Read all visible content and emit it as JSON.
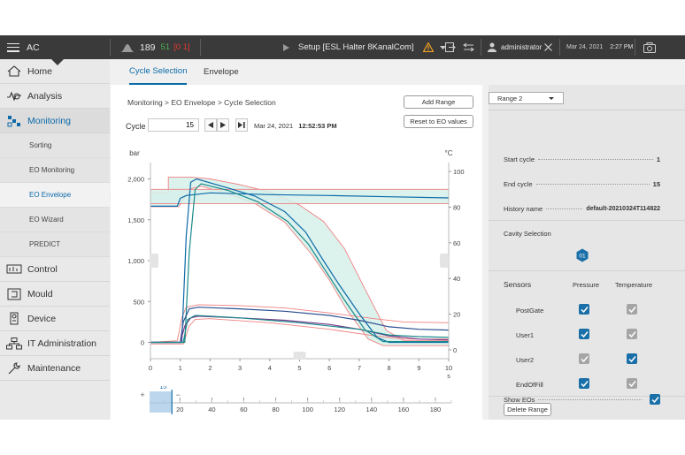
{
  "app": {
    "name": "AC"
  },
  "topbar": {
    "cycle_counter": "189",
    "status_counts": {
      "green": "51",
      "red_bracket": "[0 1]"
    },
    "setup_title": "Setup [ESL Halter 8KanalCom]",
    "user": "administrator",
    "date": "Mar 24, 2021",
    "time": "2:27 PM",
    "colors": {
      "bar": "#3a3a3a",
      "green": "#4caf50",
      "red": "#e53935",
      "warning": "#f0a020"
    }
  },
  "sidebar": {
    "items": [
      {
        "label": "Home",
        "icon": "home-icon"
      },
      {
        "label": "Analysis",
        "icon": "analysis-icon"
      },
      {
        "label": "Monitoring",
        "icon": "monitoring-icon",
        "active": true
      },
      {
        "label": "Control",
        "icon": "control-icon"
      },
      {
        "label": "Mould",
        "icon": "mould-icon"
      },
      {
        "label": "Device",
        "icon": "device-icon"
      },
      {
        "label": "IT Administration",
        "icon": "it-admin-icon"
      },
      {
        "label": "Maintenance",
        "icon": "maintenance-icon"
      }
    ],
    "subitems": [
      {
        "label": "Sorting"
      },
      {
        "label": "EO Monitoring"
      },
      {
        "label": "EO Envelope",
        "active": true
      },
      {
        "label": "EO Wizard"
      },
      {
        "label": "PREDICT"
      }
    ]
  },
  "tabs": [
    {
      "label": "Cycle Selection",
      "active": true
    },
    {
      "label": "Envelope"
    }
  ],
  "main": {
    "breadcrumb": "Monitoring > EO Envelope > Cycle Selection",
    "cycle_label": "Cycle",
    "cycle_value": "15",
    "cycle_date": "Mar 24, 2021",
    "cycle_time": "12:52:53 PM",
    "add_range_label": "Add Range",
    "reset_label": "Reset to EO values"
  },
  "chart_data": {
    "type": "line",
    "y_left_label": "bar",
    "y_right_label": "°C",
    "x_unit": "s",
    "xlim": [
      0,
      10
    ],
    "ylim_left": [
      -200,
      2200
    ],
    "ylim_right": [
      -5,
      105
    ],
    "x_ticks": [
      "0",
      "1",
      "2",
      "3",
      "4",
      "5",
      "6",
      "7",
      "8",
      "9",
      "10"
    ],
    "y_left_ticks": [
      "2,000",
      "1,500",
      "1,000",
      "500",
      "0"
    ],
    "y_left_tick_values": [
      2000,
      1500,
      1000,
      500,
      0
    ],
    "y_right_ticks": [
      "100",
      "80",
      "60",
      "40",
      "20",
      "0"
    ],
    "y_right_tick_values": [
      100,
      80,
      60,
      40,
      20,
      0
    ],
    "envelopes": [
      {
        "axis": "left",
        "color": "#f08080",
        "fill": "#d6f0ea",
        "upper": [
          [
            0,
            1830
          ],
          [
            0.6,
            1830
          ],
          [
            0.6,
            2020
          ],
          [
            1.4,
            2020
          ],
          [
            2.0,
            2000
          ],
          [
            3.0,
            1930
          ],
          [
            4.0,
            1840
          ],
          [
            5.0,
            1680
          ],
          [
            5.8,
            1480
          ],
          [
            6.5,
            1150
          ],
          [
            7.2,
            650
          ],
          [
            7.9,
            150
          ],
          [
            8.5,
            20
          ],
          [
            10,
            20
          ]
        ],
        "lower": [
          [
            0,
            1660
          ],
          [
            0.95,
            1660
          ],
          [
            1.35,
            1880
          ],
          [
            1.7,
            1910
          ],
          [
            2.5,
            1830
          ],
          [
            3.5,
            1700
          ],
          [
            4.5,
            1470
          ],
          [
            5.4,
            1080
          ],
          [
            6.0,
            760
          ],
          [
            6.6,
            390
          ],
          [
            7.3,
            40
          ],
          [
            7.8,
            -40
          ],
          [
            10,
            -40
          ]
        ]
      },
      {
        "axis": "left",
        "color": "#f08080",
        "fill": "none",
        "upper": [
          [
            0,
            0
          ],
          [
            0.9,
            20
          ],
          [
            1.05,
            300
          ],
          [
            1.2,
            430
          ],
          [
            1.6,
            460
          ],
          [
            3,
            450
          ],
          [
            4.5,
            420
          ],
          [
            6,
            360
          ],
          [
            7.5,
            290
          ],
          [
            8.5,
            250
          ],
          [
            10,
            240
          ]
        ],
        "lower": [
          [
            0,
            -20
          ],
          [
            1.1,
            -20
          ],
          [
            1.3,
            200
          ],
          [
            1.5,
            280
          ],
          [
            2,
            290
          ],
          [
            4,
            240
          ],
          [
            6,
            160
          ],
          [
            7.5,
            80
          ],
          [
            8.5,
            40
          ],
          [
            10,
            40
          ]
        ]
      },
      {
        "axis": "right",
        "color": "#f08080",
        "fill": "#d6f0ea",
        "upper": [
          [
            0,
            90
          ],
          [
            10,
            90
          ]
        ],
        "lower": [
          [
            0,
            82
          ],
          [
            10,
            82
          ]
        ]
      }
    ],
    "series": [
      {
        "name": "Temperature",
        "axis": "right",
        "color": "#0b6aa8",
        "points": [
          [
            0,
            80.5
          ],
          [
            0.9,
            80.5
          ],
          [
            1.0,
            85
          ],
          [
            1.2,
            86.5
          ],
          [
            2,
            88
          ],
          [
            4,
            87
          ],
          [
            6,
            86.5
          ],
          [
            8,
            85.8
          ],
          [
            10,
            85.2
          ]
        ]
      },
      {
        "name": "Pressure",
        "axis": "left",
        "color": "#0b6aa8",
        "points": [
          [
            0,
            0
          ],
          [
            1.05,
            0
          ],
          [
            1.2,
            1300
          ],
          [
            1.35,
            1960
          ],
          [
            1.55,
            2000
          ],
          [
            2.5,
            1900
          ],
          [
            3.5,
            1790
          ],
          [
            4.5,
            1600
          ],
          [
            5.2,
            1350
          ],
          [
            5.8,
            1000
          ],
          [
            6.3,
            720
          ],
          [
            7.0,
            350
          ],
          [
            7.6,
            60
          ],
          [
            8.0,
            0
          ],
          [
            10,
            0
          ]
        ]
      },
      {
        "name": "Pressure",
        "axis": "left",
        "color": "#1a8a8a",
        "points": [
          [
            0,
            0
          ],
          [
            1.15,
            0
          ],
          [
            1.3,
            1100
          ],
          [
            1.5,
            1870
          ],
          [
            1.7,
            1940
          ],
          [
            2.6,
            1860
          ],
          [
            3.6,
            1720
          ],
          [
            4.6,
            1480
          ],
          [
            5.3,
            1200
          ],
          [
            5.9,
            860
          ],
          [
            6.5,
            520
          ],
          [
            7.2,
            150
          ],
          [
            7.8,
            10
          ],
          [
            10,
            10
          ]
        ]
      },
      {
        "name": "User1",
        "axis": "left",
        "color": "#2a4f8f",
        "points": [
          [
            0,
            0
          ],
          [
            1.0,
            0
          ],
          [
            1.1,
            250
          ],
          [
            1.3,
            410
          ],
          [
            1.6,
            430
          ],
          [
            3,
            410
          ],
          [
            4.5,
            380
          ],
          [
            6,
            330
          ],
          [
            7,
            270
          ],
          [
            8,
            190
          ],
          [
            9,
            160
          ],
          [
            10,
            150
          ]
        ]
      },
      {
        "name": "User1",
        "axis": "left",
        "color": "#7a3a8a",
        "points": [
          [
            0,
            0
          ],
          [
            1.0,
            0
          ],
          [
            1.15,
            200
          ],
          [
            1.35,
            300
          ],
          [
            1.6,
            320
          ],
          [
            3,
            300
          ],
          [
            4.5,
            270
          ],
          [
            6,
            220
          ],
          [
            7,
            160
          ],
          [
            8,
            80
          ],
          [
            9,
            40
          ],
          [
            10,
            30
          ]
        ]
      },
      {
        "name": "EndOfFill",
        "axis": "left",
        "color": "#1a8a8a",
        "points": [
          [
            0,
            0
          ],
          [
            1.1,
            0
          ],
          [
            1.25,
            280
          ],
          [
            1.5,
            330
          ],
          [
            3,
            300
          ],
          [
            5,
            240
          ],
          [
            7,
            160
          ],
          [
            8,
            90
          ],
          [
            9,
            70
          ],
          [
            10,
            60
          ]
        ]
      }
    ]
  },
  "timeline": {
    "selected": "15",
    "labels": [
      "20",
      "40",
      "60",
      "80",
      "100",
      "120",
      "140",
      "160",
      "180"
    ],
    "label_values": [
      20,
      40,
      60,
      80,
      100,
      120,
      140,
      160,
      180
    ],
    "range": [
      1,
      190
    ],
    "zoom_in": "+",
    "zoom_out": "−"
  },
  "panel": {
    "range_label": "Range 2",
    "start_cycle_label": "Start cycle",
    "start_cycle_value": "1",
    "end_cycle_label": "End cycle",
    "end_cycle_value": "15",
    "history_label": "History name",
    "history_value": "default-20210324T114822",
    "cavity_label": "Cavity Selection",
    "cavity_value": "01",
    "sensors_label": "Sensors",
    "pressure_col": "Pressure",
    "temperature_col": "Temperature",
    "sensors": [
      {
        "name": "PostGate",
        "pressure": "checked",
        "temperature": "disabled"
      },
      {
        "name": "User1",
        "pressure": "checked",
        "temperature": "disabled"
      },
      {
        "name": "User2",
        "pressure": "disabled",
        "temperature": "checked"
      },
      {
        "name": "EndOfFill",
        "pressure": "checked",
        "temperature": "disabled"
      }
    ],
    "delete_range_label": "Delete Range",
    "show_eos_label": "Show EOs",
    "show_eos_checked": true
  }
}
